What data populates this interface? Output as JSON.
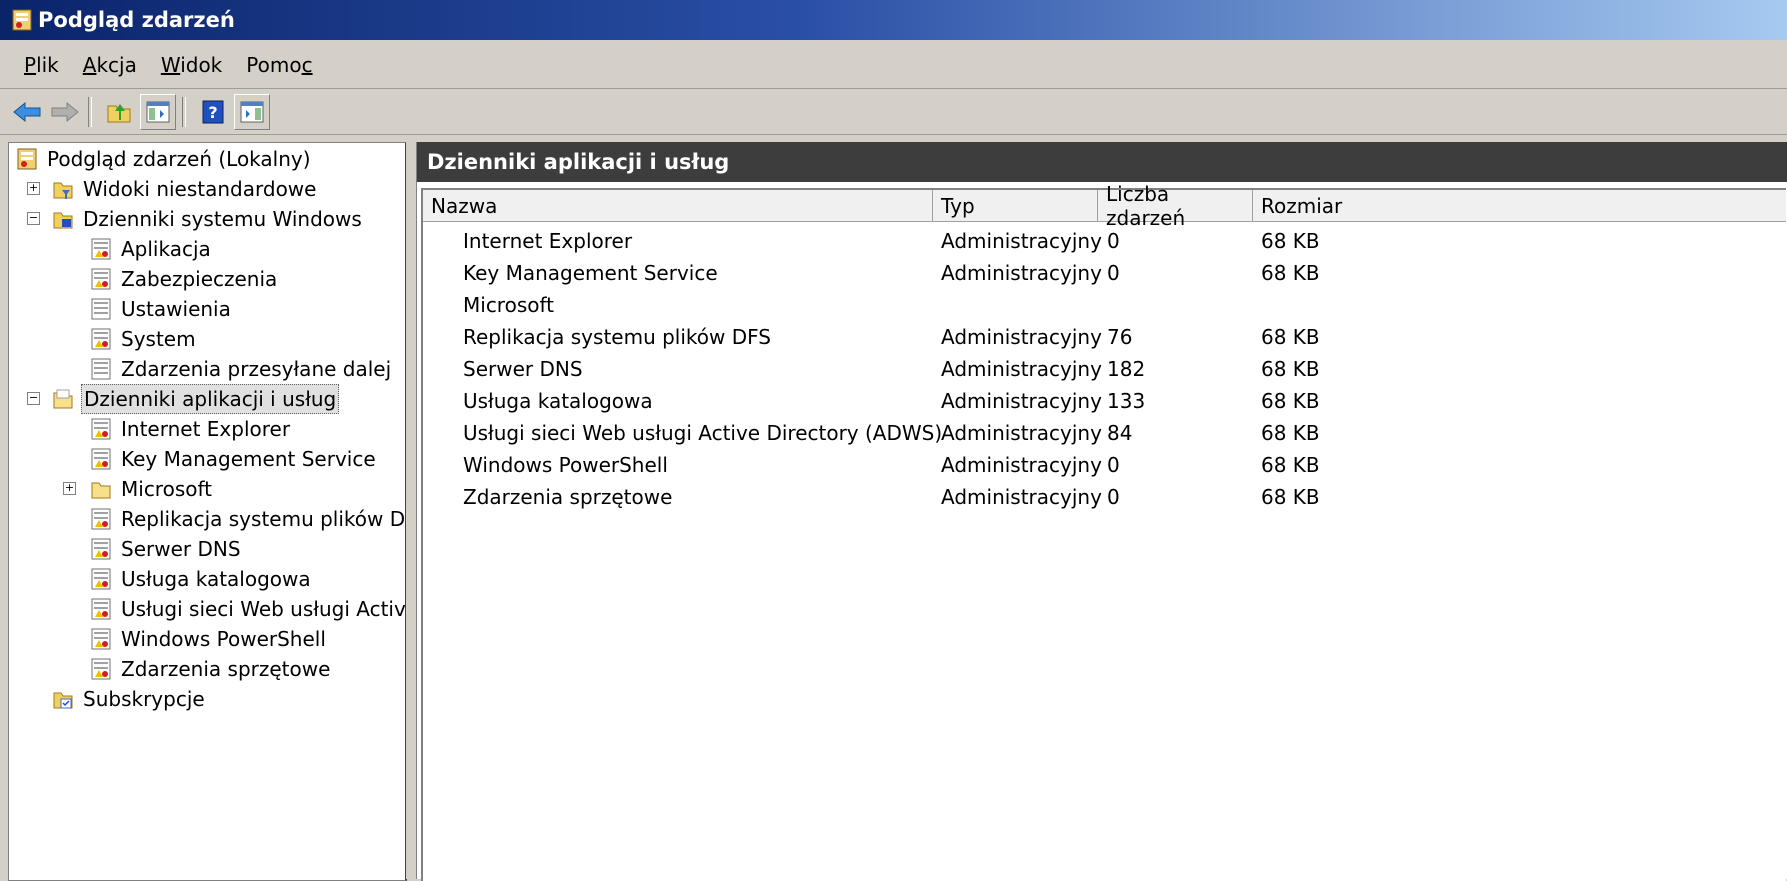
{
  "window": {
    "title": "Podgląd zdarzeń"
  },
  "menu": [
    {
      "label": "Plik",
      "underline_index": 0
    },
    {
      "label": "Akcja",
      "underline_index": 0
    },
    {
      "label": "Widok",
      "underline_index": 0
    },
    {
      "label": "Pomoc",
      "underline_index": 4
    }
  ],
  "toolbar": {
    "buttons": [
      "back-icon",
      "forward-icon",
      "up-folder-icon",
      "show-hide-console-tree-icon",
      "help-icon",
      "show-hide-action-pane-icon"
    ]
  },
  "tree": {
    "root": "Podgląd zdarzeń (Lokalny)",
    "custom_views": "Widoki niestandardowe",
    "windows_logs": "Dzienniki systemu Windows",
    "windows_log_items": [
      "Aplikacja",
      "Zabezpieczenia",
      "Ustawienia",
      "System",
      "Zdarzenia przesyłane dalej"
    ],
    "app_logs": "Dzienniki aplikacji i usług",
    "app_log_items": [
      "Internet Explorer",
      "Key Management Service",
      "Microsoft",
      "Replikacja systemu plików DFS",
      "Serwer DNS",
      "Usługa katalogowa",
      "Usługi sieci Web usługi Active D",
      "Windows PowerShell",
      "Zdarzenia sprzętowe"
    ],
    "subscriptions": "Subskrypcje"
  },
  "main": {
    "header": "Dzienniki aplikacji i usług",
    "columns": [
      "Nazwa",
      "Typ",
      "Liczba zdarzeń",
      "Rozmiar"
    ],
    "rows": [
      {
        "name": "Internet Explorer",
        "type": "Administracyjny",
        "count": "0",
        "size": "68 KB"
      },
      {
        "name": "Key Management Service",
        "type": "Administracyjny",
        "count": "0",
        "size": "68 KB"
      },
      {
        "name": "Microsoft",
        "type": "",
        "count": "",
        "size": ""
      },
      {
        "name": "Replikacja systemu plików DFS",
        "type": "Administracyjny",
        "count": "76",
        "size": "68 KB"
      },
      {
        "name": "Serwer DNS",
        "type": "Administracyjny",
        "count": "182",
        "size": "68 KB"
      },
      {
        "name": "Usługa katalogowa",
        "type": "Administracyjny",
        "count": "133",
        "size": "68 KB"
      },
      {
        "name": "Usługi sieci Web usługi Active Directory (ADWS)",
        "type": "Administracyjny",
        "count": "84",
        "size": "68 KB"
      },
      {
        "name": "Windows PowerShell",
        "type": "Administracyjny",
        "count": "0",
        "size": "68 KB"
      },
      {
        "name": "Zdarzenia sprzętowe",
        "type": "Administracyjny",
        "count": "0",
        "size": "68 KB"
      }
    ]
  }
}
